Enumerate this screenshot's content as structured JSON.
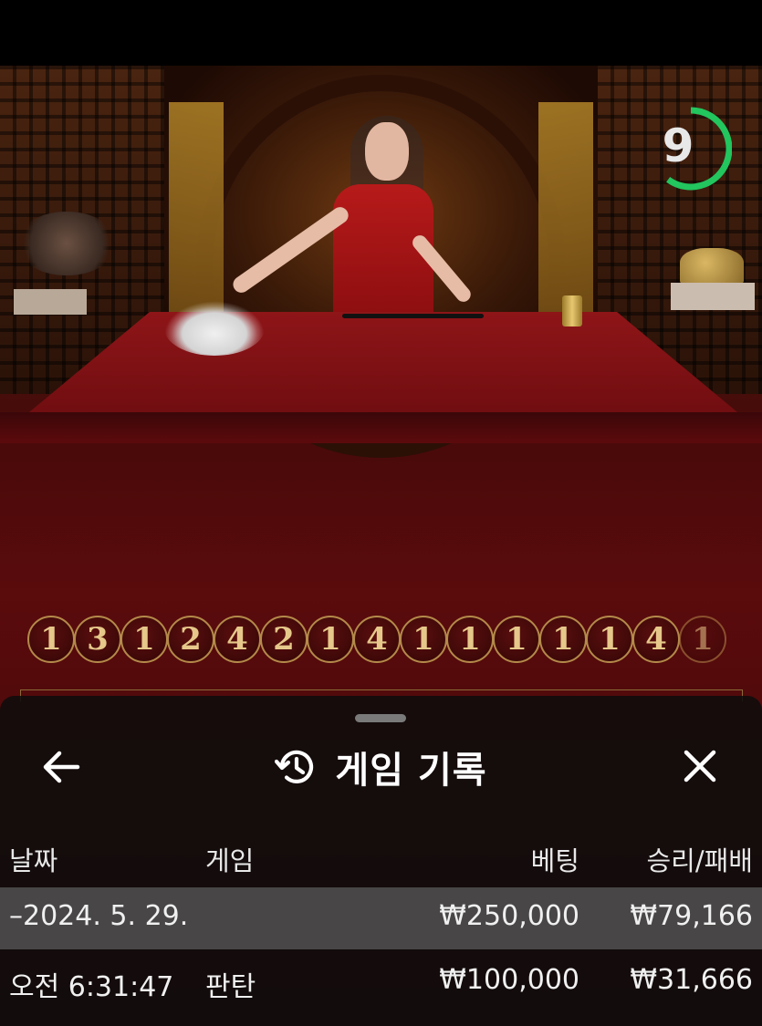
{
  "timer": {
    "value": "9",
    "remaining_fraction": 0.6,
    "ring_color": "#22c55e"
  },
  "roads": {
    "beads": [
      "1",
      "3",
      "1",
      "2",
      "4",
      "2",
      "1",
      "4",
      "1",
      "1",
      "1",
      "1",
      "1",
      "4",
      "1"
    ]
  },
  "sheet": {
    "title": "게임 기록",
    "icons": {
      "back": "arrow-left-icon",
      "history": "history-icon",
      "close": "close-icon"
    },
    "columns": {
      "date": "날짜",
      "game": "게임",
      "bet": "베팅",
      "win_loss": "승리/패배"
    },
    "date_row": {
      "date": "–2024. 5. 29.",
      "bet": "₩250,000",
      "win_loss": "₩79,166"
    },
    "rounds": [
      {
        "time": "오전 6:31:47",
        "game": "판탄",
        "bet": "₩100,000",
        "win_loss": "₩31,666"
      }
    ]
  }
}
